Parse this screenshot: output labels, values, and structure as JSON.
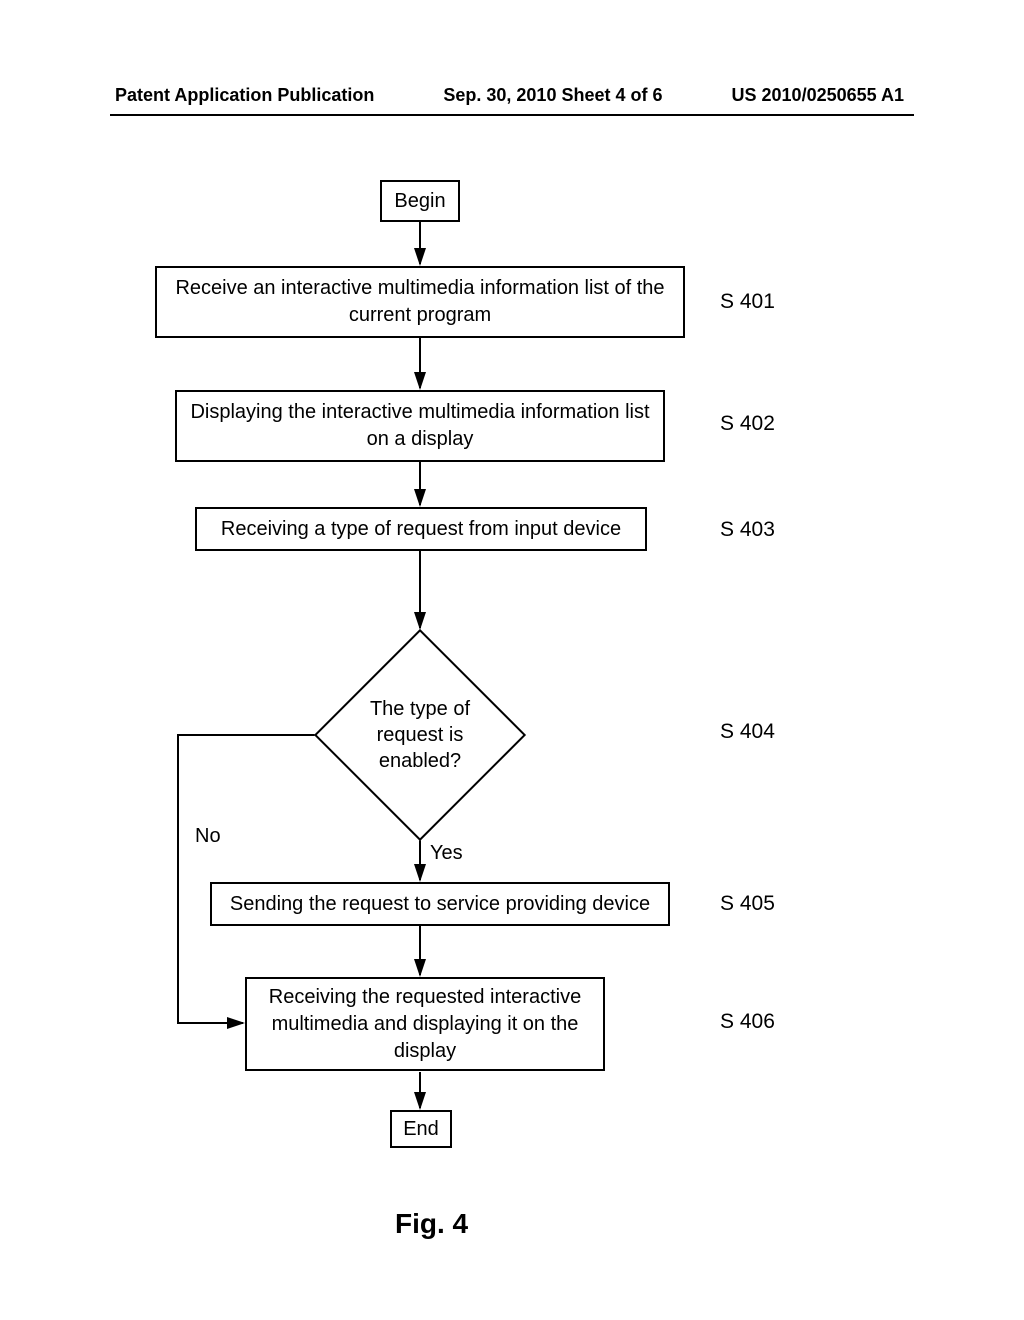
{
  "header": {
    "left": "Patent Application Publication",
    "center": "Sep. 30, 2010   Sheet 4 of 6",
    "right": "US 2010/0250655 A1"
  },
  "flow": {
    "begin": "Begin",
    "s401": {
      "text": "Receive an interactive multimedia information list of the current program",
      "ref": "S 401"
    },
    "s402": {
      "text": "Displaying the interactive multimedia information list on a display",
      "ref": "S 402"
    },
    "s403": {
      "text": "Receiving a type of request from input device",
      "ref": "S 403"
    },
    "s404": {
      "text": "The type of request is enabled?",
      "ref": "S 404",
      "yes": "Yes",
      "no": "No"
    },
    "s405": {
      "text": "Sending the request to service providing device",
      "ref": "S 405"
    },
    "s406": {
      "text": "Receiving the requested interactive multimedia and displaying it on the display",
      "ref": "S 406"
    },
    "end": "End"
  },
  "caption": "Fig. 4",
  "chart_data": {
    "type": "flowchart",
    "nodes": [
      {
        "id": "begin",
        "kind": "terminal",
        "label": "Begin"
      },
      {
        "id": "s401",
        "kind": "process",
        "ref": "S 401",
        "label": "Receive an interactive multimedia information list of the current program"
      },
      {
        "id": "s402",
        "kind": "process",
        "ref": "S 402",
        "label": "Displaying the interactive multimedia information list on a display"
      },
      {
        "id": "s403",
        "kind": "process",
        "ref": "S 403",
        "label": "Receiving a type of request from input device"
      },
      {
        "id": "s404",
        "kind": "decision",
        "ref": "S 404",
        "label": "The type of request is enabled?"
      },
      {
        "id": "s405",
        "kind": "process",
        "ref": "S 405",
        "label": "Sending the request to service providing device"
      },
      {
        "id": "s406",
        "kind": "process",
        "ref": "S 406",
        "label": "Receiving the requested interactive multimedia and displaying it on the display"
      },
      {
        "id": "end",
        "kind": "terminal",
        "label": "End"
      }
    ],
    "edges": [
      {
        "from": "begin",
        "to": "s401"
      },
      {
        "from": "s401",
        "to": "s402"
      },
      {
        "from": "s402",
        "to": "s403"
      },
      {
        "from": "s403",
        "to": "s404"
      },
      {
        "from": "s404",
        "to": "s405",
        "label": "Yes"
      },
      {
        "from": "s404",
        "to": "s406",
        "label": "No"
      },
      {
        "from": "s405",
        "to": "s406"
      },
      {
        "from": "s406",
        "to": "end"
      }
    ]
  }
}
